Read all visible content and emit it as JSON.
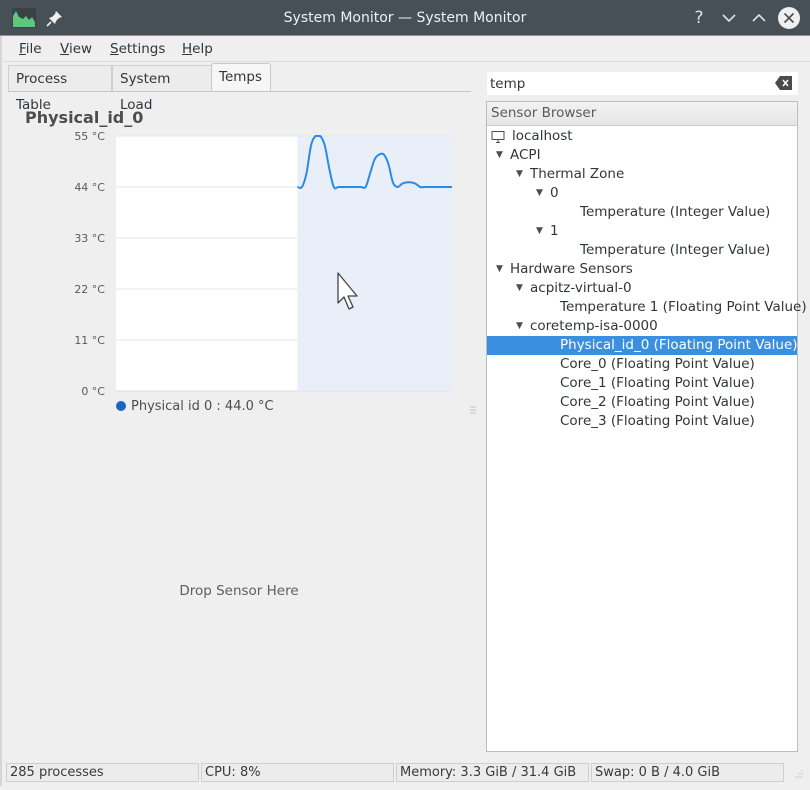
{
  "window": {
    "title": "System Monitor — System Monitor",
    "buttons": {
      "help": "?",
      "minimize": "minimize",
      "maximize": "maximize",
      "close": "close"
    }
  },
  "menubar": {
    "items": [
      {
        "label": "File",
        "mnemonic": "F",
        "rest": "ile"
      },
      {
        "label": "View",
        "mnemonic": "V",
        "rest": "iew"
      },
      {
        "label": "Settings",
        "mnemonic": "S",
        "rest": "ettings"
      },
      {
        "label": "Help",
        "mnemonic": "H",
        "rest": "elp"
      }
    ]
  },
  "tabs": [
    {
      "label": "Process Table",
      "active": false
    },
    {
      "label": "System Load",
      "active": false
    },
    {
      "label": "Temps",
      "active": true
    }
  ],
  "chart_panel": {
    "title": "Physical_id_0",
    "legend": {
      "label": "Physical id 0 : 44.0 °C",
      "color": "#1d63c3"
    },
    "drop_placeholder": "Drop Sensor Here"
  },
  "chart_data": {
    "type": "line",
    "title": "Physical_id_0",
    "xlabel": "",
    "ylabel": "",
    "ylim": [
      0,
      55
    ],
    "y_ticks": [
      "0 °C",
      "11 °C",
      "22 °C",
      "33 °C",
      "44 °C",
      "55 °C"
    ],
    "y_tick_values": [
      0,
      11,
      22,
      33,
      44,
      55
    ],
    "grid": true,
    "legend_position": "bottom-left",
    "series": [
      {
        "name": "Physical id 0",
        "color": "#2b8ae6",
        "fill": "#e8eff8",
        "history_fraction_filled": 0.46,
        "values": [
          44,
          44,
          47,
          53,
          55,
          55,
          53,
          48,
          44,
          44,
          44,
          44,
          44,
          44,
          44,
          44,
          47,
          50,
          51,
          51,
          49,
          45,
          44,
          44.7,
          45,
          45,
          44.7,
          44,
          44,
          44,
          44,
          44,
          44,
          44,
          44
        ]
      }
    ]
  },
  "search": {
    "value": "temp",
    "placeholder": ""
  },
  "sensor_browser": {
    "header": "Sensor Browser",
    "rows": [
      {
        "label": "localhost",
        "level": 0,
        "type": "host",
        "expanded": null,
        "selected": false
      },
      {
        "label": "ACPI",
        "level": 0,
        "type": "group",
        "expanded": true,
        "selected": false
      },
      {
        "label": "Thermal Zone",
        "level": 1,
        "type": "group",
        "expanded": true,
        "selected": false
      },
      {
        "label": "0",
        "level": 2,
        "type": "group",
        "expanded": true,
        "selected": false
      },
      {
        "label": "Temperature (Integer Value)",
        "level": 3,
        "type": "sensor",
        "expanded": null,
        "selected": false
      },
      {
        "label": "1",
        "level": 2,
        "type": "group",
        "expanded": true,
        "selected": false
      },
      {
        "label": "Temperature (Integer Value)",
        "level": 3,
        "type": "sensor",
        "expanded": null,
        "selected": false
      },
      {
        "label": "Hardware Sensors",
        "level": 0,
        "type": "group",
        "expanded": true,
        "selected": false
      },
      {
        "label": "acpitz-virtual-0",
        "level": 1,
        "type": "group",
        "expanded": true,
        "selected": false
      },
      {
        "label": "Temperature 1 (Floating Point Value)",
        "level": 2,
        "type": "sensor",
        "expanded": null,
        "selected": false
      },
      {
        "label": "coretemp-isa-0000",
        "level": 1,
        "type": "group",
        "expanded": true,
        "selected": false
      },
      {
        "label": "Physical_id_0 (Floating Point Value)",
        "level": 2,
        "type": "sensor",
        "expanded": null,
        "selected": true
      },
      {
        "label": "Core_0 (Floating Point Value)",
        "level": 2,
        "type": "sensor",
        "expanded": null,
        "selected": false
      },
      {
        "label": "Core_1 (Floating Point Value)",
        "level": 2,
        "type": "sensor",
        "expanded": null,
        "selected": false
      },
      {
        "label": "Core_2 (Floating Point Value)",
        "level": 2,
        "type": "sensor",
        "expanded": null,
        "selected": false
      },
      {
        "label": "Core_3 (Floating Point Value)",
        "level": 2,
        "type": "sensor",
        "expanded": null,
        "selected": false
      }
    ]
  },
  "statusbar": {
    "processes": "285 processes",
    "cpu": "CPU: 8%",
    "memory": "Memory: 3.3 GiB / 31.4 GiB",
    "swap": "Swap: 0 B / 4.0 GiB"
  },
  "colors": {
    "titlebar": "#475057",
    "accent": "#3daee9",
    "selection": "#3b8fe0"
  }
}
